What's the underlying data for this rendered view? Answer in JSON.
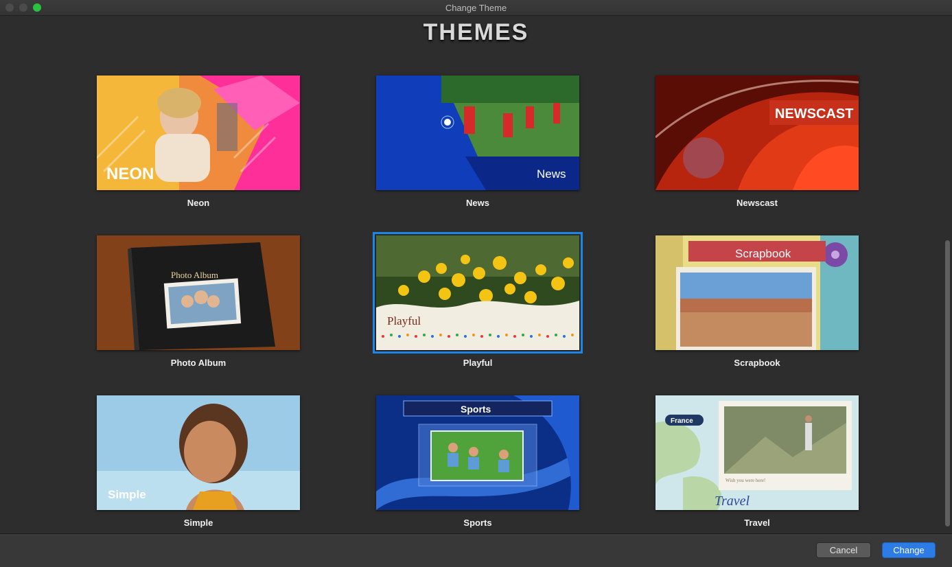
{
  "window": {
    "title": "Change Theme"
  },
  "heading": "THEMES",
  "themes": [
    {
      "name": "Neon",
      "overlay": "NEON"
    },
    {
      "name": "News",
      "overlay": "News"
    },
    {
      "name": "Newscast",
      "overlay": "NEWSCAST"
    },
    {
      "name": "Photo Album",
      "overlay": "Photo Album"
    },
    {
      "name": "Playful",
      "overlay": "Playful",
      "selected": true
    },
    {
      "name": "Scrapbook",
      "overlay": "Scrapbook"
    },
    {
      "name": "Simple",
      "overlay": "Simple"
    },
    {
      "name": "Sports",
      "overlay": "Sports"
    },
    {
      "name": "Travel",
      "overlay": "Travel",
      "tag": "France",
      "postcard_text": "Wish you were here!"
    }
  ],
  "buttons": {
    "cancel": "Cancel",
    "change": "Change"
  },
  "colors": {
    "accent": "#1e86e6",
    "window_bg": "#2d2d2d"
  }
}
